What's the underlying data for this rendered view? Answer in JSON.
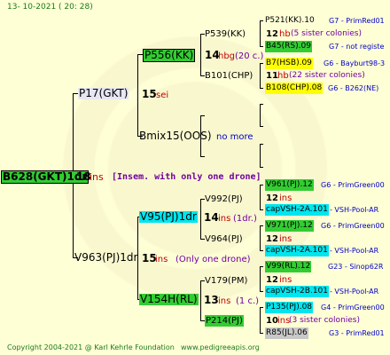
{
  "date": "13- 10-2021 ( 20: 28)",
  "copyright": "Copyright 2004-2021 @ Karl Kehrle Foundation",
  "site": "www.pedigreeapis.org",
  "root": {
    "name": "B628(GKT)1dr",
    "num": "18",
    "suffix": "ins",
    "note": "[Insem. with only one drone]"
  },
  "gen1": {
    "upper": {
      "name": "P17(GKT)",
      "num": "15",
      "suffix": "sei"
    },
    "lower": {
      "name": "V963(PJ)1dr",
      "num": "15",
      "suffix": "ins",
      "note": "(Only one drone)"
    }
  },
  "gen2": {
    "a": {
      "name": "P556(KK)",
      "num": "14",
      "suffix": "hbg",
      "note": "(20 c.)"
    },
    "b": {
      "name": "Bmix15(OOS)",
      "note": "no more"
    },
    "c": {
      "name": "V95(PJ)1dr",
      "num": "14",
      "suffix": "ins",
      "note": "(1dr.)"
    },
    "d": {
      "name": "V154H(RL)",
      "num": "13",
      "suffix": "ins",
      "note": "(1 c.)"
    }
  },
  "gen3": {
    "a1": {
      "name": "P539(KK)",
      "num": "12",
      "suffix": "hb",
      "note": "(5 sister colonies)"
    },
    "a2": {
      "name": "B101(CHP)",
      "num": "11",
      "suffix": "hb",
      "note": "(22 sister colonies)"
    },
    "c1": {
      "name": "V992(PJ)",
      "num": "12",
      "suffix": "ins"
    },
    "c2": {
      "name": "V964(PJ)",
      "num": "12",
      "suffix": "ins"
    },
    "d1": {
      "name": "V179(PM)",
      "num": "12",
      "suffix": "ins"
    },
    "d2": {
      "name": "P214(PJ)",
      "num": "10",
      "suffix": "ins",
      "note": "(3 sister colonies)"
    }
  },
  "gen4": [
    {
      "name": "P521(KK).10",
      "info": "G7 - PrimRed01"
    },
    {
      "name": "B45(RS).09",
      "info": "G7 - not registe"
    },
    {
      "name": "B7(HSB).09",
      "info": "G6 - Bayburt98-3"
    },
    {
      "name": "B108(CHP).08",
      "info": "G6 - B262(NE)"
    },
    {
      "name": "V961(PJ).12",
      "info": "G6 - PrimGreen00"
    },
    {
      "name": "capVSH-2A.101",
      "info": "- VSH-Pool-AR"
    },
    {
      "name": "V971(PJ).12",
      "info": "G6 - PrimGreen00"
    },
    {
      "name": "capVSH-2A.101",
      "info": "- VSH-Pool-AR"
    },
    {
      "name": "V99(RL).12",
      "info": "G23 - Sinop62R"
    },
    {
      "name": "capVSH-2B.101",
      "info": "- VSH-Pool-AR"
    },
    {
      "name": "P135(PJ).08",
      "info": "G4 - PrimGreen00"
    },
    {
      "name": "R85(JL).06",
      "info": "G3 - PrimRed01"
    }
  ]
}
